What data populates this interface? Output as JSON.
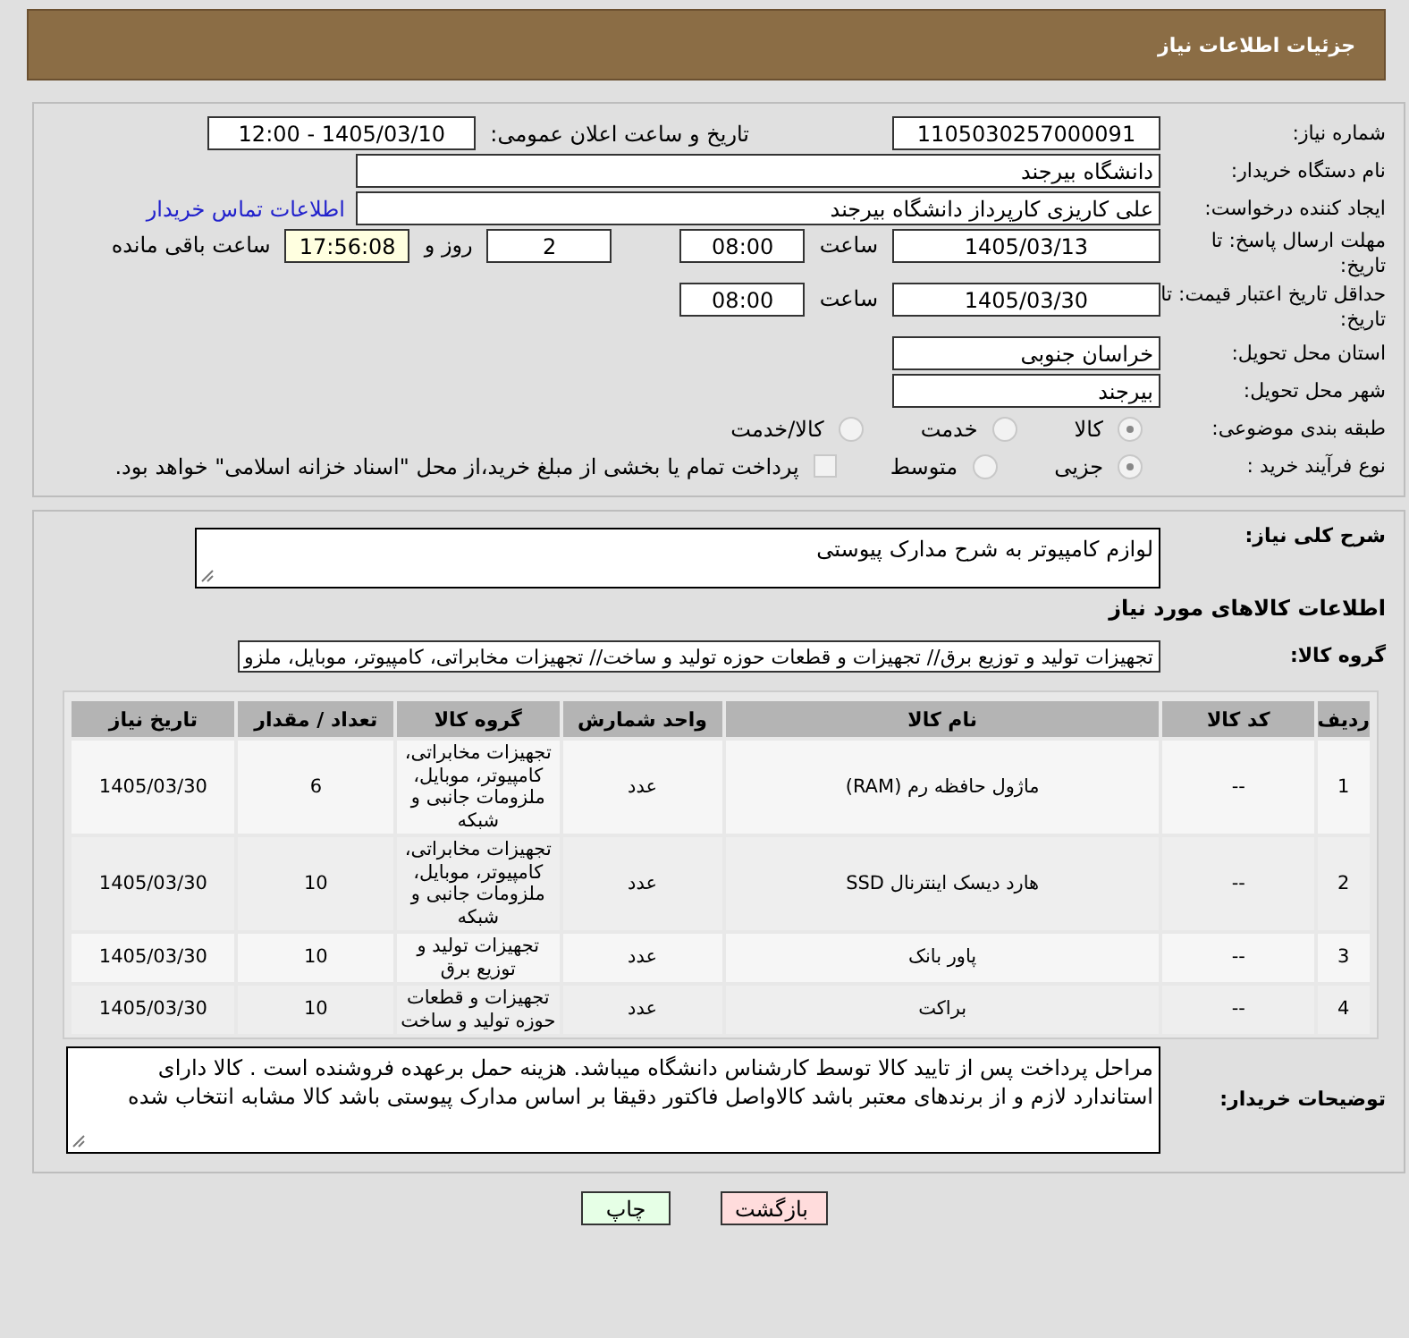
{
  "header": {
    "title": "جزئیات اطلاعات نیاز"
  },
  "fields": {
    "need_number": {
      "label": "شماره نیاز:",
      "value": "1105030257000091"
    },
    "announce": {
      "label": "تاریخ و ساعت اعلان عمومی:",
      "value": "1405/03/10 - 12:00"
    },
    "buyer": {
      "label": "نام دستگاه خریدار:",
      "value": "دانشگاه بیرجند"
    },
    "creator": {
      "label": "ایجاد کننده درخواست:",
      "value": "علی کاریزی کارپرداز دانشگاه بیرجند",
      "link": "اطلاعات تماس خریدار"
    },
    "deadline": {
      "label": "مهلت ارسال پاسخ: تا تاریخ:",
      "date": "1405/03/13",
      "time_label": "ساعت",
      "time": "08:00",
      "days": "2",
      "days_label": "روز و",
      "remaining": "17:56:08",
      "remaining_label": "ساعت باقی مانده"
    },
    "validity": {
      "label": "حداقل تاریخ اعتبار قیمت: تا تاریخ:",
      "date": "1405/03/30",
      "time_label": "ساعت",
      "time": "08:00"
    },
    "province": {
      "label": "استان محل تحویل:",
      "value": "خراسان جنوبی"
    },
    "city": {
      "label": "شهر محل تحویل:",
      "value": "بیرجند"
    }
  },
  "category": {
    "label": "طبقه بندی موضوعی:",
    "options": [
      {
        "label": "کالا",
        "selected": true
      },
      {
        "label": "خدمت",
        "selected": false
      },
      {
        "label": "کالا/خدمت",
        "selected": false
      }
    ]
  },
  "process": {
    "label": "نوع فرآیند خرید :",
    "options": [
      {
        "label": "جزیی",
        "selected": true
      },
      {
        "label": "متوسط",
        "selected": false
      }
    ],
    "treasury": {
      "label": "پرداخت تمام یا بخشی از مبلغ خرید،از محل \"اسناد خزانه اسلامی\" خواهد بود.",
      "checked": false
    }
  },
  "summary": {
    "label": "شرح کلی نیاز:",
    "value": "لوازم کامپیوتر به شرح مدارک پیوستی"
  },
  "goods_heading": "اطلاعات کالاهای مورد نیاز",
  "goods_group": {
    "label": "گروه کالا:",
    "value": "تجهیزات تولید و توزیع برق// تجهیزات و قطعات حوزه تولید و ساخت// تجهیزات مخابراتی، کامپیوتر، موبایل، ملزو"
  },
  "table": {
    "columns": [
      "ردیف",
      "کد کالا",
      "نام کالا",
      "واحد شمارش",
      "گروه کالا",
      "تعداد / مقدار",
      "تاریخ نیاز"
    ],
    "rows": [
      [
        "1",
        "--",
        "ماژول حافظه رم (RAM)",
        "عدد",
        "تجهیزات مخابراتی، کامپیوتر، موبایل، ملزومات جانبی و شبکه",
        "6",
        "1405/03/30"
      ],
      [
        "2",
        "--",
        "هارد دیسک اینترنال SSD",
        "عدد",
        "تجهیزات مخابراتی، کامپیوتر، موبایل، ملزومات جانبی و شبکه",
        "10",
        "1405/03/30"
      ],
      [
        "3",
        "--",
        "پاور بانک",
        "عدد",
        "تجهیزات تولید و توزیع برق",
        "10",
        "1405/03/30"
      ],
      [
        "4",
        "--",
        "براکت",
        "عدد",
        "تجهیزات و قطعات حوزه تولید و ساخت",
        "10",
        "1405/03/30"
      ]
    ]
  },
  "notes": {
    "label": "توضیحات خریدار:",
    "value": "مراحل پرداخت پس از تایید کالا توسط کارشناس دانشگاه میباشد. هزینه حمل برعهده فروشنده است . کالا دارای استاندارد لازم و از برندهای معتبر باشد کالاواصل فاکتور دقیقا بر اساس مدارک پیوستی باشد کالا مشابه انتخاب شده"
  },
  "buttons": [
    {
      "label": "بازگشت",
      "kind": "back"
    },
    {
      "label": "چاپ",
      "kind": "print"
    }
  ]
}
